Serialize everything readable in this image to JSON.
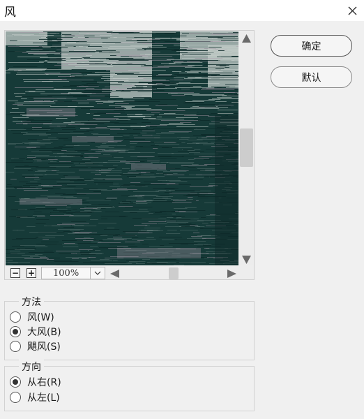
{
  "window": {
    "title": "风",
    "close_icon": "close-icon"
  },
  "preview": {
    "zoom_value": "100%",
    "zoom_out_label": "−",
    "zoom_in_label": "+"
  },
  "buttons": {
    "ok_label": "确定",
    "default_label": "默认"
  },
  "method": {
    "legend": "方法",
    "options": [
      {
        "label": "风(W)",
        "checked": false
      },
      {
        "label": "大风(B)",
        "checked": true
      },
      {
        "label": "飓风(S)",
        "checked": false
      }
    ]
  },
  "direction": {
    "legend": "方向",
    "options": [
      {
        "label": "从右(R)",
        "checked": true
      },
      {
        "label": "从左(L)",
        "checked": false
      }
    ]
  },
  "colors": {
    "preview_dark": "#163a38",
    "preview_light": "#c3ccc8",
    "preview_lilac": "#a89aa9"
  }
}
